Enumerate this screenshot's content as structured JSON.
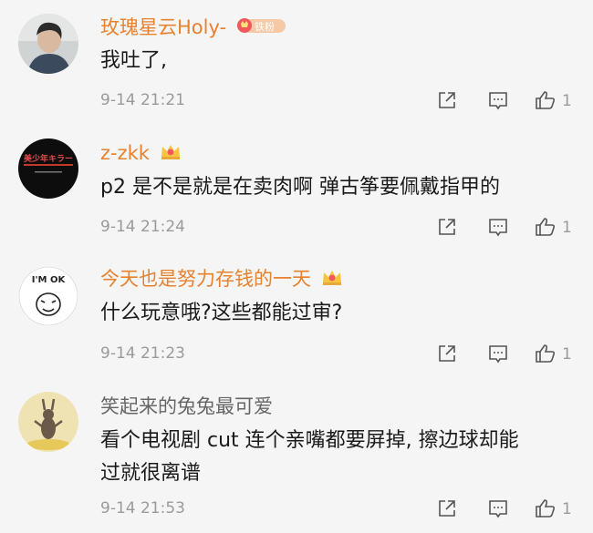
{
  "comments": [
    {
      "username": "玫瑰星云Holy-",
      "badge": "铁粉",
      "text_lines": [
        "我吐了,"
      ],
      "time": "9-14 21:21",
      "likes": "1",
      "name_color": "#e7822f",
      "avatar_icon": "person-photo-icon"
    },
    {
      "username": "z-zkk",
      "badge": "",
      "text_lines": [
        "p2 是不是就是在卖肉啊 弹古筝要佩戴指甲的"
      ],
      "time": "9-14 21:24",
      "likes": "1",
      "name_color": "#e7822f",
      "avatar_text": "美少年キラー",
      "avatar_icon": "black-logo-avatar"
    },
    {
      "username": "今天也是努力存钱的一天",
      "badge": "",
      "text_lines": [
        "什么玩意哦?这些都能过审?"
      ],
      "time": "9-14 21:23",
      "likes": "1",
      "name_color": "#e7822f",
      "avatar_text": "I'M OK",
      "avatar_icon": "meme-face-avatar"
    },
    {
      "username": "笑起来的兔兔最可爱",
      "badge": "",
      "text_lines": [
        "看个电视剧 cut 连个亲嘴都要屏掉, 擦边球却能",
        "过就很离谱"
      ],
      "time": "9-14 21:53",
      "likes": "1",
      "name_color": "#666666",
      "avatar_icon": "rabbit-figure-avatar"
    }
  ],
  "colors": {
    "accent_orange": "#e7822f",
    "meta_gray": "#9a9a9a",
    "background": "#f5f5f5",
    "badge_red": "#f0585c",
    "crown_yellow": "#f5c542"
  }
}
